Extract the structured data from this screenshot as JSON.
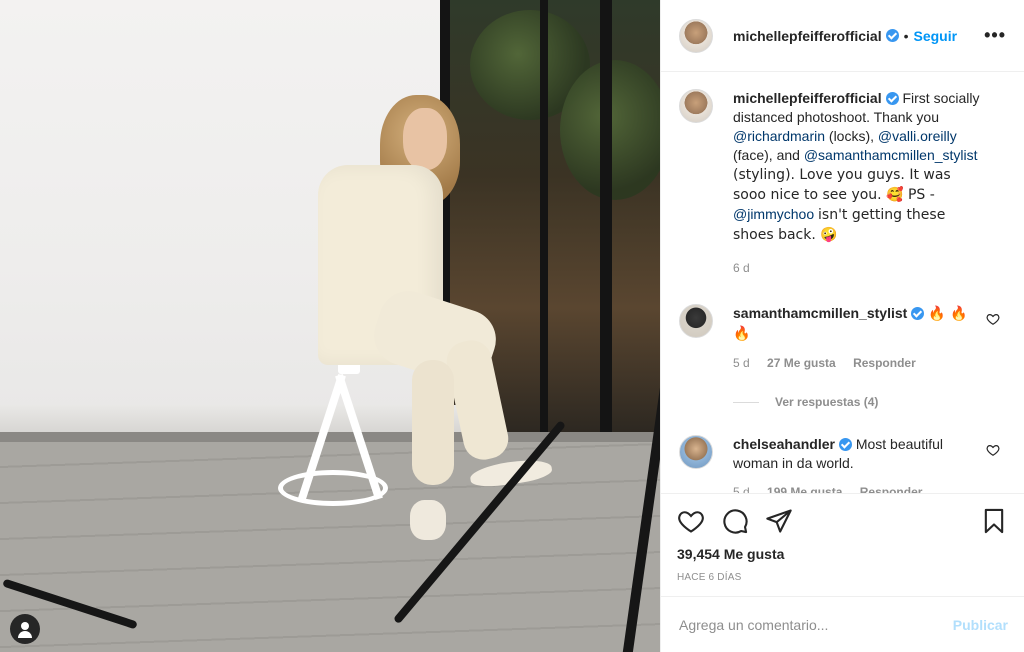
{
  "post": {
    "username": "michellepfeifferofficial",
    "follow_label": "Seguir",
    "dot": "•",
    "more_label": "•••"
  },
  "caption": {
    "username": "michellepfeifferofficial",
    "text_1": "First socially distanced photoshoot. Thank you",
    "mention_1": "@richardmarin",
    "text_2": "(locks),",
    "mention_2": "@valli.oreilly",
    "text_3": "(face), and",
    "mention_3": "@samanthamcmillen_stylist",
    "text_4": "(styling). Love you guys. It was sooo nice to see you. 🥰 PS -",
    "mention_4": "@jimmychoo",
    "text_5": "isn't getting these shoes back. 🤪",
    "age": "6 d"
  },
  "comments": [
    {
      "username": "samanthamcmillen_stylist",
      "text": "🔥 🔥🔥",
      "age": "5 d",
      "likes": "27 Me gusta",
      "reply_label": "Responder",
      "view_replies": "Ver respuestas (4)"
    },
    {
      "username": "chelseahandler",
      "text": "Most beautiful woman in da world.",
      "age": "5 d",
      "likes": "199 Me gusta",
      "reply_label": "Responder"
    }
  ],
  "stats": {
    "likes": "39,454 Me gusta",
    "time": "HACE 6 DÍAS"
  },
  "composer": {
    "placeholder": "Agrega un comentario...",
    "post_label": "Publicar"
  },
  "colors": {
    "link": "#00376b",
    "accent": "#0095f6",
    "verified": "#3897f0",
    "muted": "#8e8e8e"
  },
  "icons": [
    "heart-icon",
    "comment-icon",
    "share-icon",
    "bookmark-icon",
    "verified-icon",
    "more-options-icon",
    "user-tag-icon"
  ]
}
